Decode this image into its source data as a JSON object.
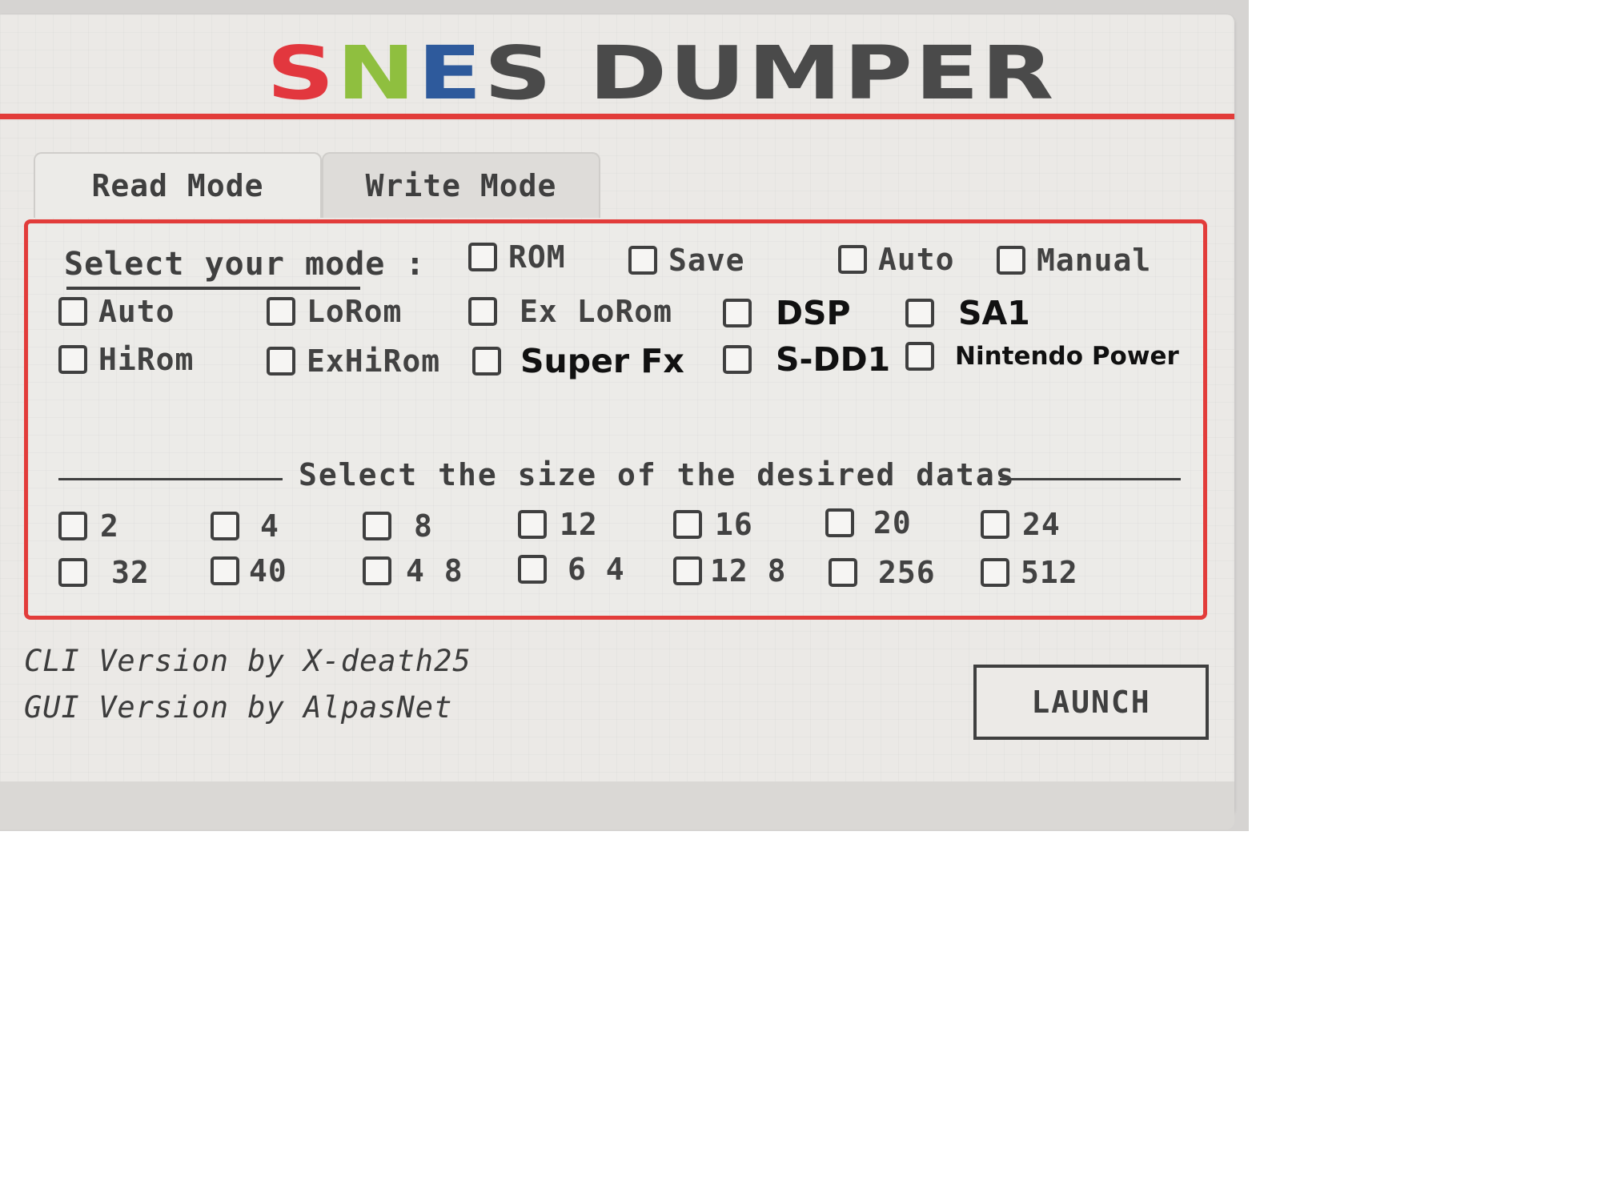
{
  "header": {
    "logo_letters": [
      {
        "char": "S",
        "color": "#e2373e"
      },
      {
        "char": "N",
        "color": "#8fbf3f"
      },
      {
        "char": "E",
        "color": "#2e5a9c"
      },
      {
        "char": "S",
        "color": "#4a4a4a"
      },
      {
        "char": " ",
        "color": "#4a4a4a"
      },
      {
        "char": "D",
        "color": "#4a4a4a"
      },
      {
        "char": "U",
        "color": "#4a4a4a"
      },
      {
        "char": "M",
        "color": "#4a4a4a"
      },
      {
        "char": "P",
        "color": "#4a4a4a"
      },
      {
        "char": "E",
        "color": "#4a4a4a"
      },
      {
        "char": "R",
        "color": "#4a4a4a"
      }
    ],
    "accent_color": "#e23c3a"
  },
  "tabs": [
    {
      "label": "Read Mode",
      "active": true
    },
    {
      "label": "Write Mode",
      "active": false
    }
  ],
  "mode": {
    "label": "Select your mode :",
    "options": [
      "ROM",
      "Save",
      "Auto",
      "Manual"
    ]
  },
  "mapping": {
    "row1": [
      "Auto",
      "LoRom",
      "Ex LoRom",
      "DSP",
      "SA1"
    ],
    "row2": [
      "HiRom",
      "ExHiRom",
      "Super Fx",
      "S-DD1",
      "Nintendo Power"
    ]
  },
  "size": {
    "title": "Select the size of the desired datas",
    "row1": [
      "2",
      "4",
      "8",
      "12",
      "16",
      "20",
      "24"
    ],
    "row2": [
      "32",
      "40",
      "4 8",
      "6 4",
      "12 8",
      "256",
      "512"
    ]
  },
  "credits": {
    "cli": "CLI Version by X-death25",
    "gui": "GUI Version by AlpasNet"
  },
  "launch_label": "LAUNCH"
}
